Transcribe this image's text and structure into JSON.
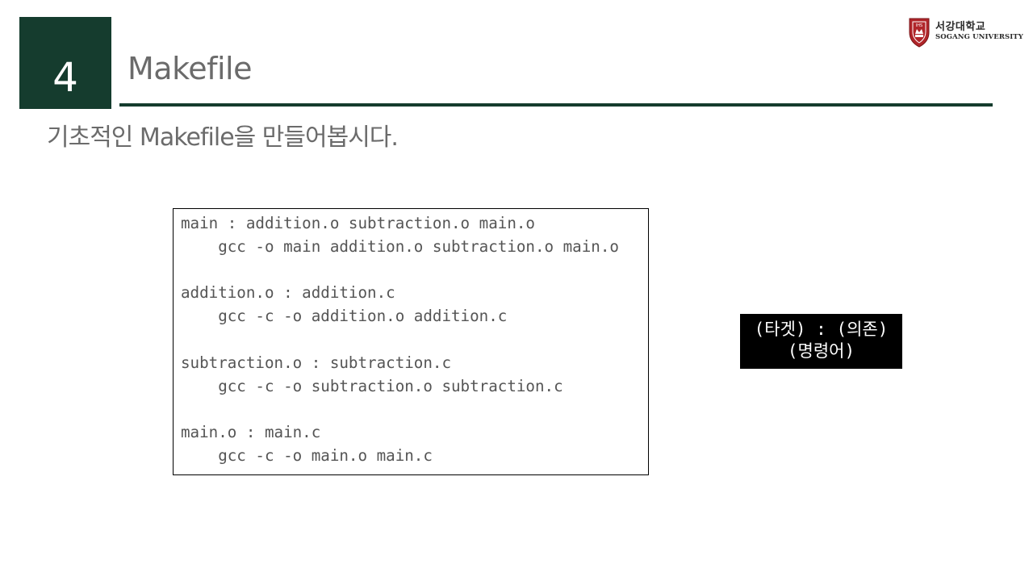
{
  "slide": {
    "section_number": "4",
    "title": "Makefile",
    "subtitle": "기초적인 Makefile을 만들어봅시다."
  },
  "logo": {
    "korean_name": "서강대학교",
    "english_name": "SOGANG UNIVERSITY",
    "crest_text": "IHS",
    "crest_color": "#b0252a"
  },
  "code": {
    "lines": [
      "main : addition.o subtraction.o main.o",
      "    gcc -o main addition.o subtraction.o main.o",
      "",
      "addition.o : addition.c",
      "    gcc -c -o addition.o addition.c",
      "",
      "subtraction.o : subtraction.c",
      "    gcc -c -o subtraction.o subtraction.c",
      "",
      "main.o : main.c",
      "    gcc -c -o main.o main.c"
    ]
  },
  "annotation": {
    "line1": "(타겟) : (의존)",
    "line2": "(명령어)"
  },
  "colors": {
    "accent": "#153c2e",
    "text_gray": "#6b6b6b",
    "code_text": "#555555"
  }
}
